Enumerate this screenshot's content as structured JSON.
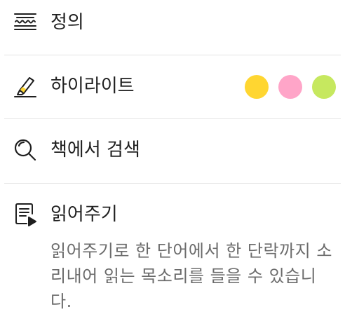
{
  "menu": {
    "items": [
      {
        "label": "정의",
        "icon": "dictionary-icon"
      },
      {
        "label": "하이라이트",
        "icon": "highlighter-icon"
      },
      {
        "label": "책에서 검색",
        "icon": "search-icon"
      },
      {
        "label": "읽어주기",
        "icon": "read-aloud-icon"
      }
    ],
    "highlight_colors": [
      {
        "name": "yellow",
        "hex": "#FFD631"
      },
      {
        "name": "pink",
        "hex": "#FFA5C8"
      },
      {
        "name": "green",
        "hex": "#C6E85F"
      }
    ],
    "read_aloud_description": "읽어주기로 한 단어에서 한 단락까지 소리내어 읽는 목소리를 들을 수 있습니다."
  }
}
